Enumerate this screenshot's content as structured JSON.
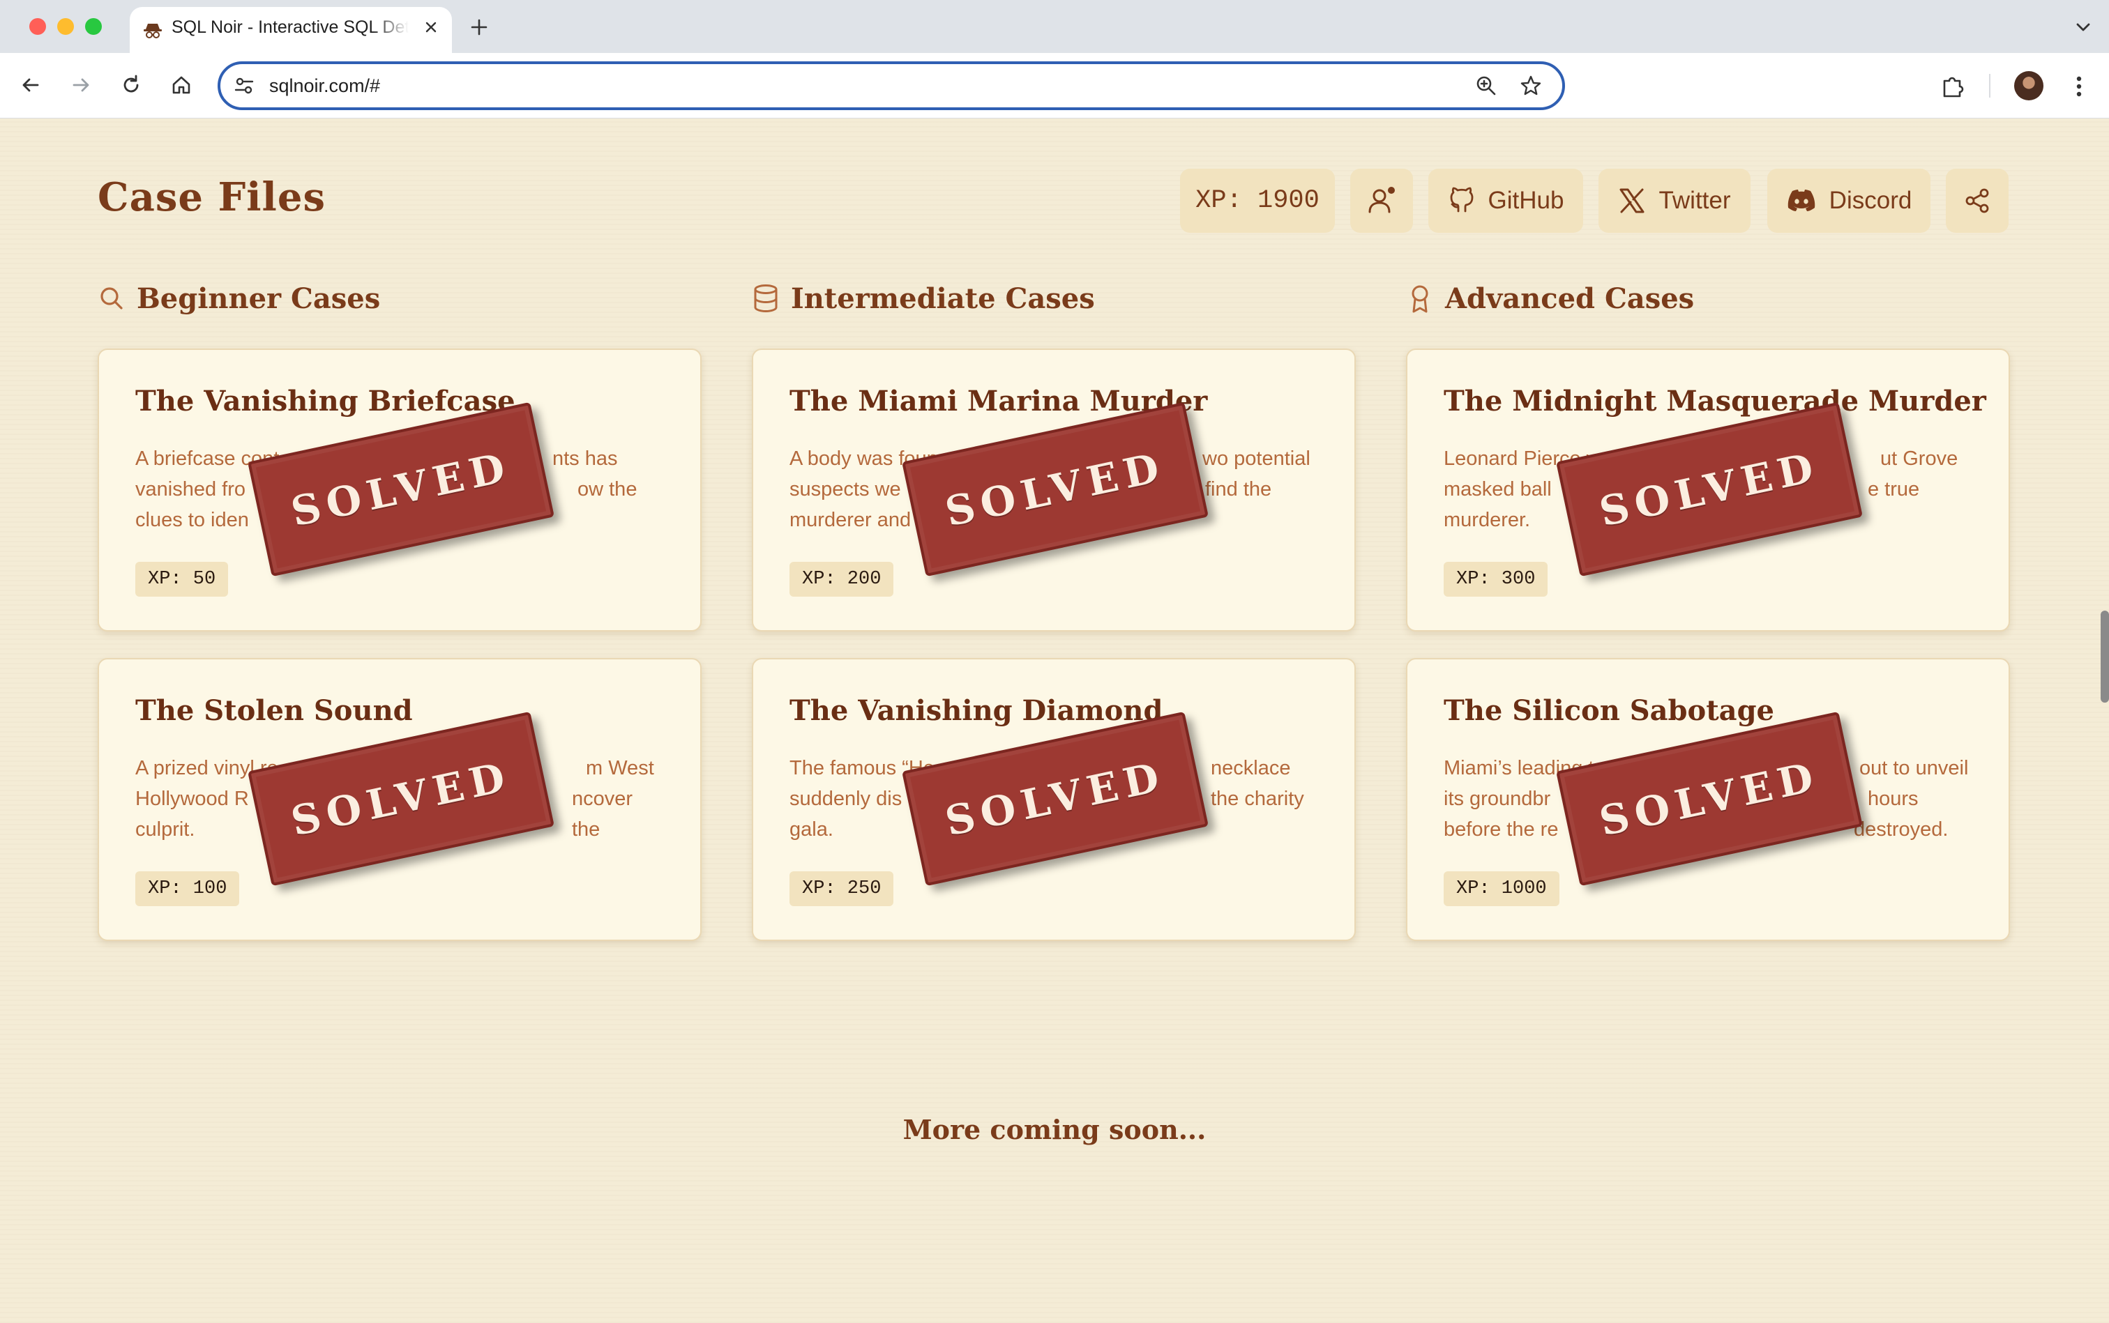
{
  "browser": {
    "tab_title": "SQL Noir - Interactive SQL Detective Game",
    "url": "sqlnoir.com/#"
  },
  "header": {
    "title": "Case Files",
    "xp_label": "XP: 1900",
    "github_label": "GitHub",
    "twitter_label": "Twitter",
    "discord_label": "Discord"
  },
  "sections": [
    {
      "label": "Beginner Cases",
      "icon": "search-icon",
      "cases": [
        {
          "title": "The Vanishing Briefcase",
          "desc_visible": [
            "A briefcase cont",
            "nts has",
            "vanished fro",
            "ow the",
            "clues to iden"
          ],
          "xp": "XP: 50",
          "status": "SOLVED"
        },
        {
          "title": "The Stolen Sound",
          "desc_visible": [
            "A prized vinyl re",
            "m West",
            "Hollywood R",
            "ncover the",
            "culprit."
          ],
          "xp": "XP: 100",
          "status": "SOLVED"
        }
      ]
    },
    {
      "label": "Intermediate Cases",
      "icon": "database-icon",
      "cases": [
        {
          "title": "The Miami Marina Murder",
          "desc_visible": [
            "A body was foun",
            "wo potential",
            "suspects we",
            "find the",
            "murderer and"
          ],
          "xp": "XP: 200",
          "status": "SOLVED"
        },
        {
          "title": "The Vanishing Diamond",
          "desc_visible": [
            "The famous “Hea",
            "necklace",
            "suddenly dis",
            "the charity",
            "gala."
          ],
          "xp": "XP: 250",
          "status": "SOLVED"
        }
      ]
    },
    {
      "label": "Advanced Cases",
      "icon": "award-icon",
      "cases": [
        {
          "title": "The Midnight Masquerade Murder",
          "desc_visible": [
            "Leonard Pierce w",
            "ut Grove",
            "masked ball",
            "e true",
            "murderer."
          ],
          "xp": "XP: 300",
          "status": "SOLVED"
        },
        {
          "title": "The Silicon Sabotage",
          "desc_visible": [
            "Miami’s leading t",
            "out to unveil",
            "its groundbr",
            "hours",
            "before the re",
            "destroyed."
          ],
          "xp": "XP: 1000",
          "status": "SOLVED"
        }
      ]
    }
  ],
  "footer_text": "More coming soon...",
  "colors": {
    "background": "#f4ecd6",
    "accent_brown": "#7a3b1a",
    "card_bg": "#fdf8e6",
    "stamp_red": "#9d3932"
  }
}
